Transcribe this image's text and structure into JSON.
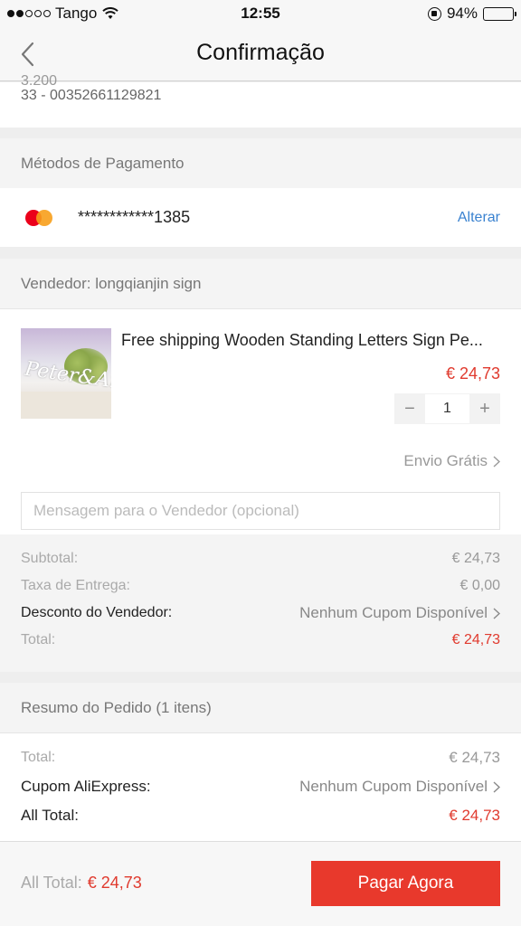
{
  "status_bar": {
    "carrier": "Tango",
    "time": "12:55",
    "battery": "94%",
    "signal_dots_filled": 2,
    "signal_dots_total": 5
  },
  "nav": {
    "title": "Confirmação"
  },
  "address": {
    "partial_line": "3.200",
    "phone": "33 - 00352661129821"
  },
  "payment": {
    "heading": "Métodos de Pagamento",
    "card_number": "************1385",
    "change_label": "Alterar",
    "card_icon": "mastercard-icon"
  },
  "seller": {
    "heading": "Vendedor: longqianjin sign",
    "product": {
      "title": "Free shipping Wooden Standing  Letters Sign Pe...",
      "price": "€ 24,73",
      "quantity": "1",
      "decrease": "−",
      "increase": "+"
    },
    "shipping": "Envio Grátis",
    "message_placeholder": "Mensagem para o Vendedor (opcional)",
    "summary": [
      {
        "label": "Subtotal:",
        "value": "€ 24,73"
      },
      {
        "label": "Taxa de Entrega:",
        "value": "€ 0,00"
      },
      {
        "label": "Desconto do Vendedor:",
        "value": "Nenhum Cupom Disponível"
      },
      {
        "label": "Total:",
        "value": "€ 24,73"
      }
    ]
  },
  "order_summary": {
    "heading": "Resumo do Pedido (1 itens)",
    "rows": [
      {
        "label": "Total:",
        "value": "€ 24,73"
      },
      {
        "label": "Cupom AliExpress:",
        "value": "Nenhum Cupom Disponível"
      },
      {
        "label": "All Total:",
        "value": "€ 24,73"
      }
    ]
  },
  "footer": {
    "total_label": "All Total:",
    "total_value": "€ 24,73",
    "pay_button": "Pagar Agora"
  },
  "colors": {
    "accent_red": "#e8392c",
    "link_blue": "#3a82d0",
    "price_red": "#e03a2e"
  }
}
